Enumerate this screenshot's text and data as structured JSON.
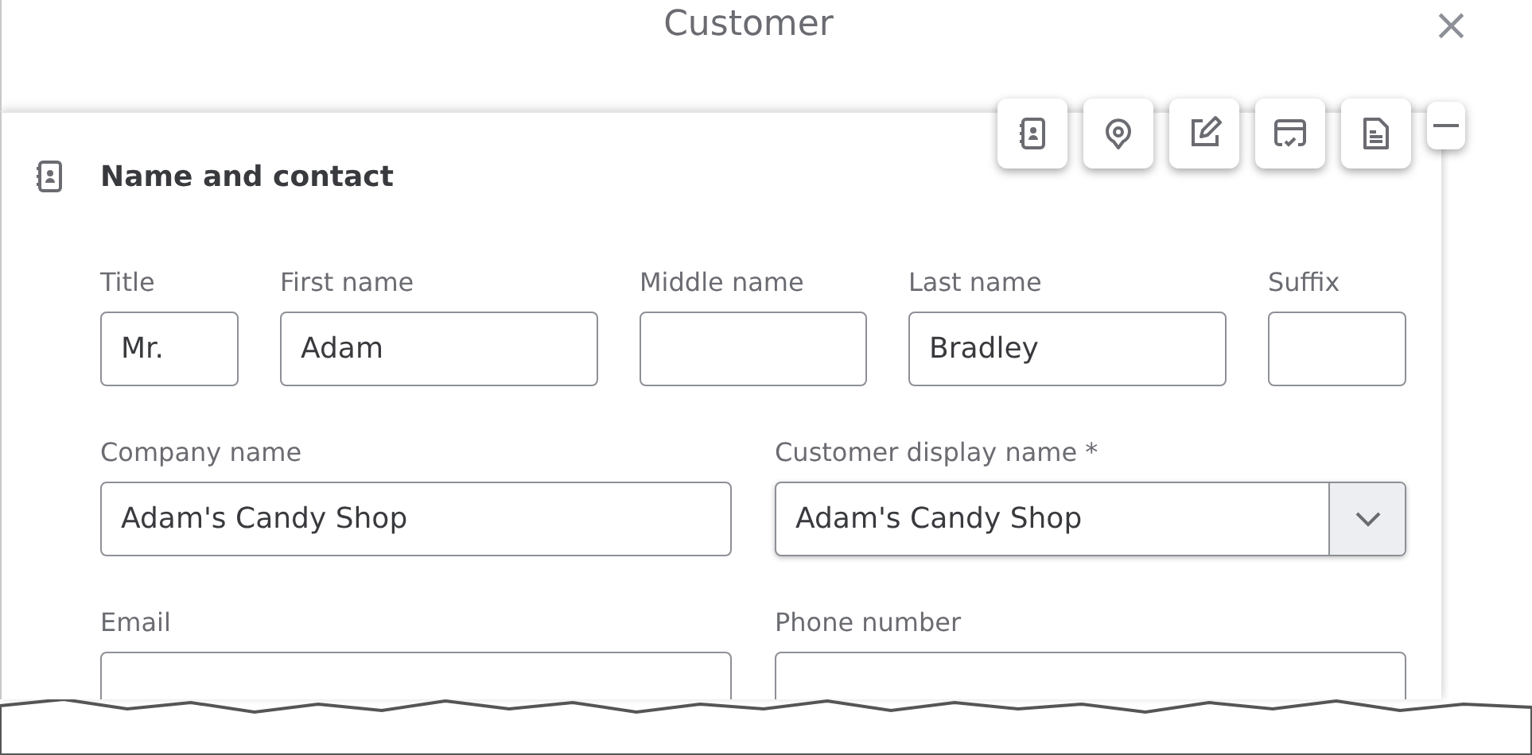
{
  "window": {
    "title": "Customer",
    "close": "×"
  },
  "toolbar": [
    {
      "kind": "contacts"
    },
    {
      "kind": "location"
    },
    {
      "kind": "edit"
    },
    {
      "kind": "payment"
    },
    {
      "kind": "document"
    },
    {
      "kind": "collapse"
    }
  ],
  "section": {
    "title": "Name and contact"
  },
  "rows": [
    [
      {
        "label": "Title",
        "value": "Mr.",
        "kind": "text"
      },
      {
        "label": "First name",
        "value": "Adam",
        "kind": "text"
      },
      {
        "label": "Middle name",
        "kind": "text"
      },
      {
        "label": "Last name",
        "value": "Bradley",
        "kind": "text"
      },
      {
        "label": "Suffix",
        "kind": "text"
      }
    ],
    [
      {
        "label": "Company name",
        "value": "Adam's Candy Shop",
        "kind": "text"
      },
      {
        "label": "Customer display name *",
        "value": "Adam's Candy Shop",
        "kind": "select"
      }
    ],
    [
      {
        "label": "Email",
        "kind": "text"
      },
      {
        "label": "Phone number",
        "kind": "text"
      }
    ]
  ]
}
